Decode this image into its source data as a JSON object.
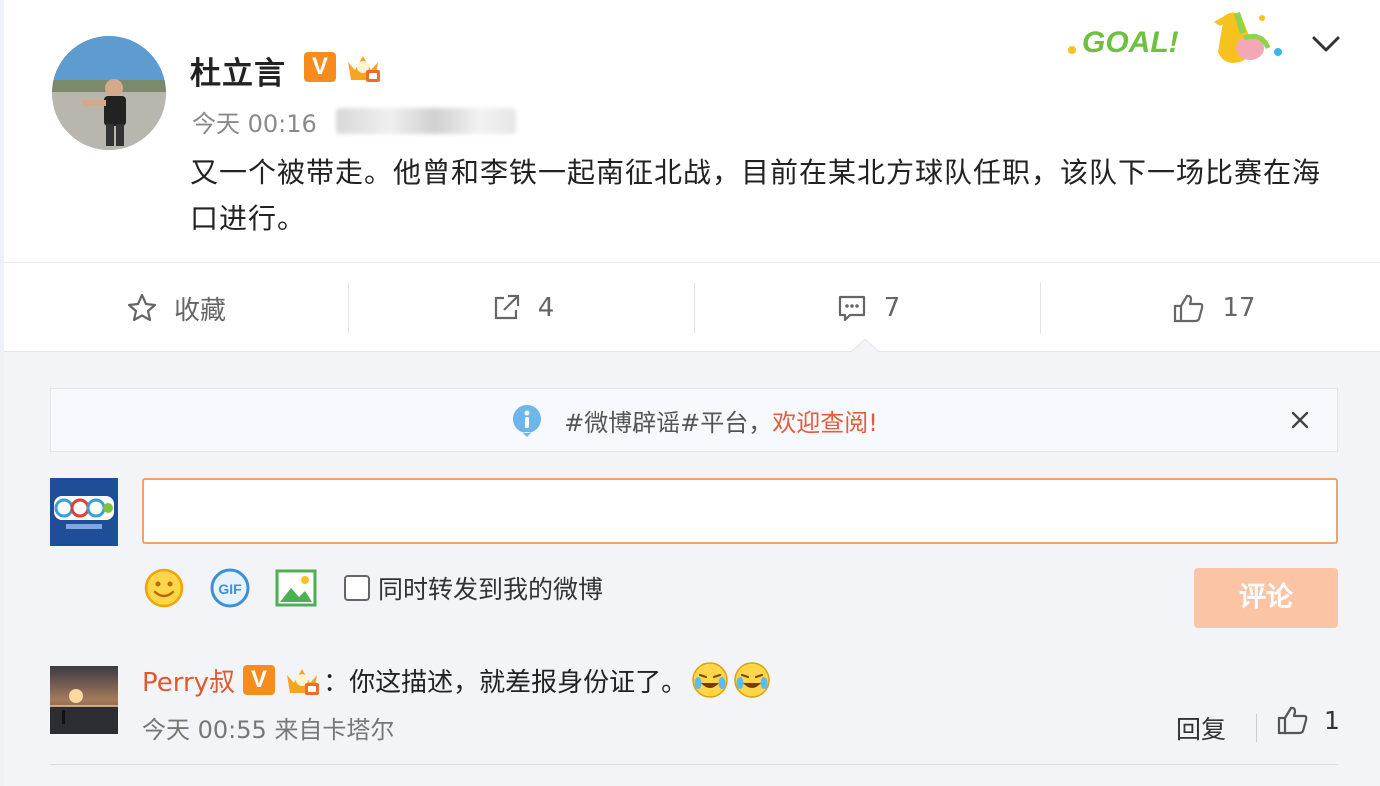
{
  "post": {
    "author": "杜立言",
    "verified_badge": "V",
    "time": "今天 00:16",
    "content": "又一个被带走。他曾和李铁一起南征北战，目前在某北方球队任职，该队下一场比赛在海口进行。",
    "decoration": "GOAL!",
    "icons": {
      "verified": "verified-v-icon",
      "crown": "crown-badge-icon",
      "menu": "chevron-down-icon"
    }
  },
  "actions": {
    "favorite_label": "收藏",
    "repost_count": "4",
    "comment_count": "7",
    "like_count": "17",
    "icons": [
      "star-icon",
      "share-icon",
      "comment-icon",
      "thumbs-up-icon"
    ]
  },
  "notice": {
    "text": "#微博辟谣#平台，",
    "link": "欢迎查阅!"
  },
  "composer": {
    "value": "",
    "repost_label": "同时转发到我的微博",
    "submit_label": "评论",
    "tools": [
      "emoji-icon",
      "gif-icon",
      "image-icon"
    ]
  },
  "comments": [
    {
      "user": "Perry叔",
      "verified_badge": "V",
      "text": "：你这描述，就差报身份证了。",
      "time": "今天 00:55 来自卡塔尔",
      "reply_label": "回复",
      "like_count": "1"
    }
  ],
  "colors": {
    "accent": "#e2592c",
    "badge": "#f78c1e",
    "submit_disabled": "#fbc4a5",
    "input_border": "#f0a26e"
  }
}
